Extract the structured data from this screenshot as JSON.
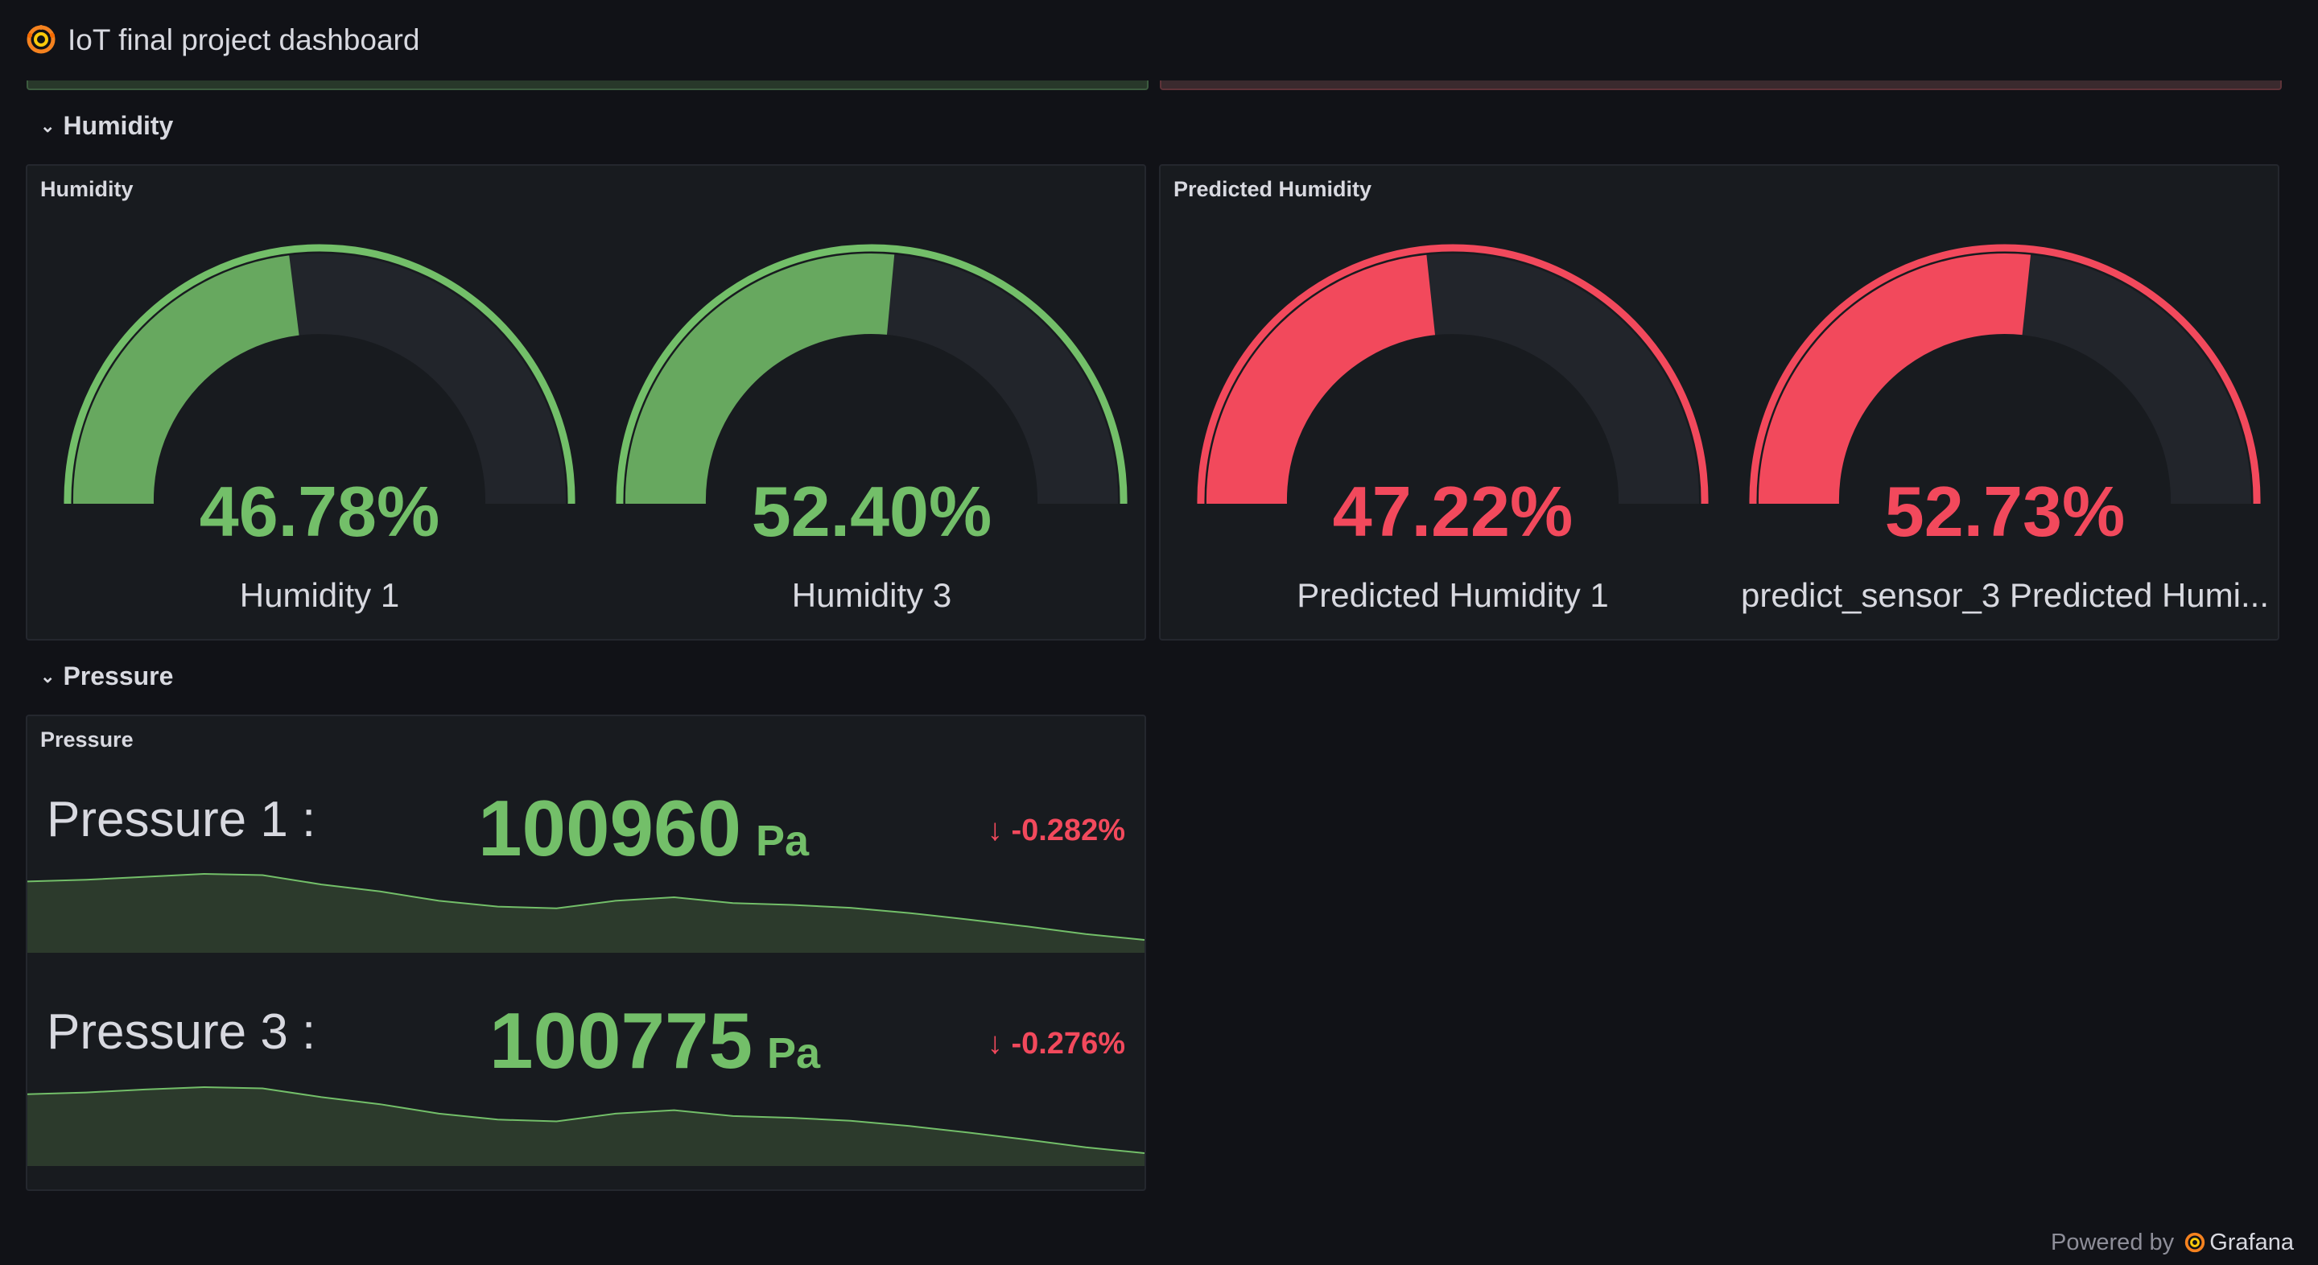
{
  "header": {
    "title": "IoT final project dashboard",
    "icon": "grafana-logo-icon"
  },
  "rows": {
    "humidity": {
      "label": "Humidity"
    },
    "pressure": {
      "label": "Pressure"
    }
  },
  "panels": {
    "humidity": {
      "title": "Humidity",
      "gauges": [
        {
          "value": "46.78%",
          "label": "Humidity 1",
          "fraction": 0.4678,
          "color": "#73bf69"
        },
        {
          "value": "52.40%",
          "label": "Humidity 3",
          "fraction": 0.524,
          "color": "#73bf69"
        }
      ]
    },
    "predicted_humidity": {
      "title": "Predicted Humidity",
      "gauges": [
        {
          "value": "47.22%",
          "label": "Predicted Humidity 1",
          "fraction": 0.4722,
          "color": "#f2495c"
        },
        {
          "value": "52.73%",
          "label": "predict_sensor_3 Predicted Humi...",
          "fraction": 0.5273,
          "color": "#f2495c"
        }
      ]
    },
    "pressure": {
      "title": "Pressure",
      "stats": [
        {
          "name": "Pressure 1 :",
          "value": "100960",
          "unit": "Pa",
          "change": "-0.282%",
          "sparkline": [
            100995,
            100998,
            101003,
            101008,
            101006,
            100990,
            100978,
            100962,
            100952,
            100949,
            100962,
            100968,
            100958,
            100955,
            100950,
            100941,
            100930,
            100918,
            100905,
            100895
          ]
        },
        {
          "name": "Pressure 3 :",
          "value": "100775",
          "unit": "Pa",
          "change": "-0.276%",
          "sparkline": [
            100810,
            100813,
            100818,
            100822,
            100820,
            100805,
            100793,
            100777,
            100767,
            100764,
            100777,
            100783,
            100773,
            100770,
            100765,
            100756,
            100745,
            100733,
            100720,
            100710
          ]
        }
      ]
    }
  },
  "footer": {
    "prefix": "Powered by",
    "brand": "Grafana"
  },
  "colors": {
    "ok": "#73bf69",
    "bad": "#f2495c",
    "track": "#22252b",
    "panel_bg": "#181b1f",
    "page_bg": "#111217"
  }
}
